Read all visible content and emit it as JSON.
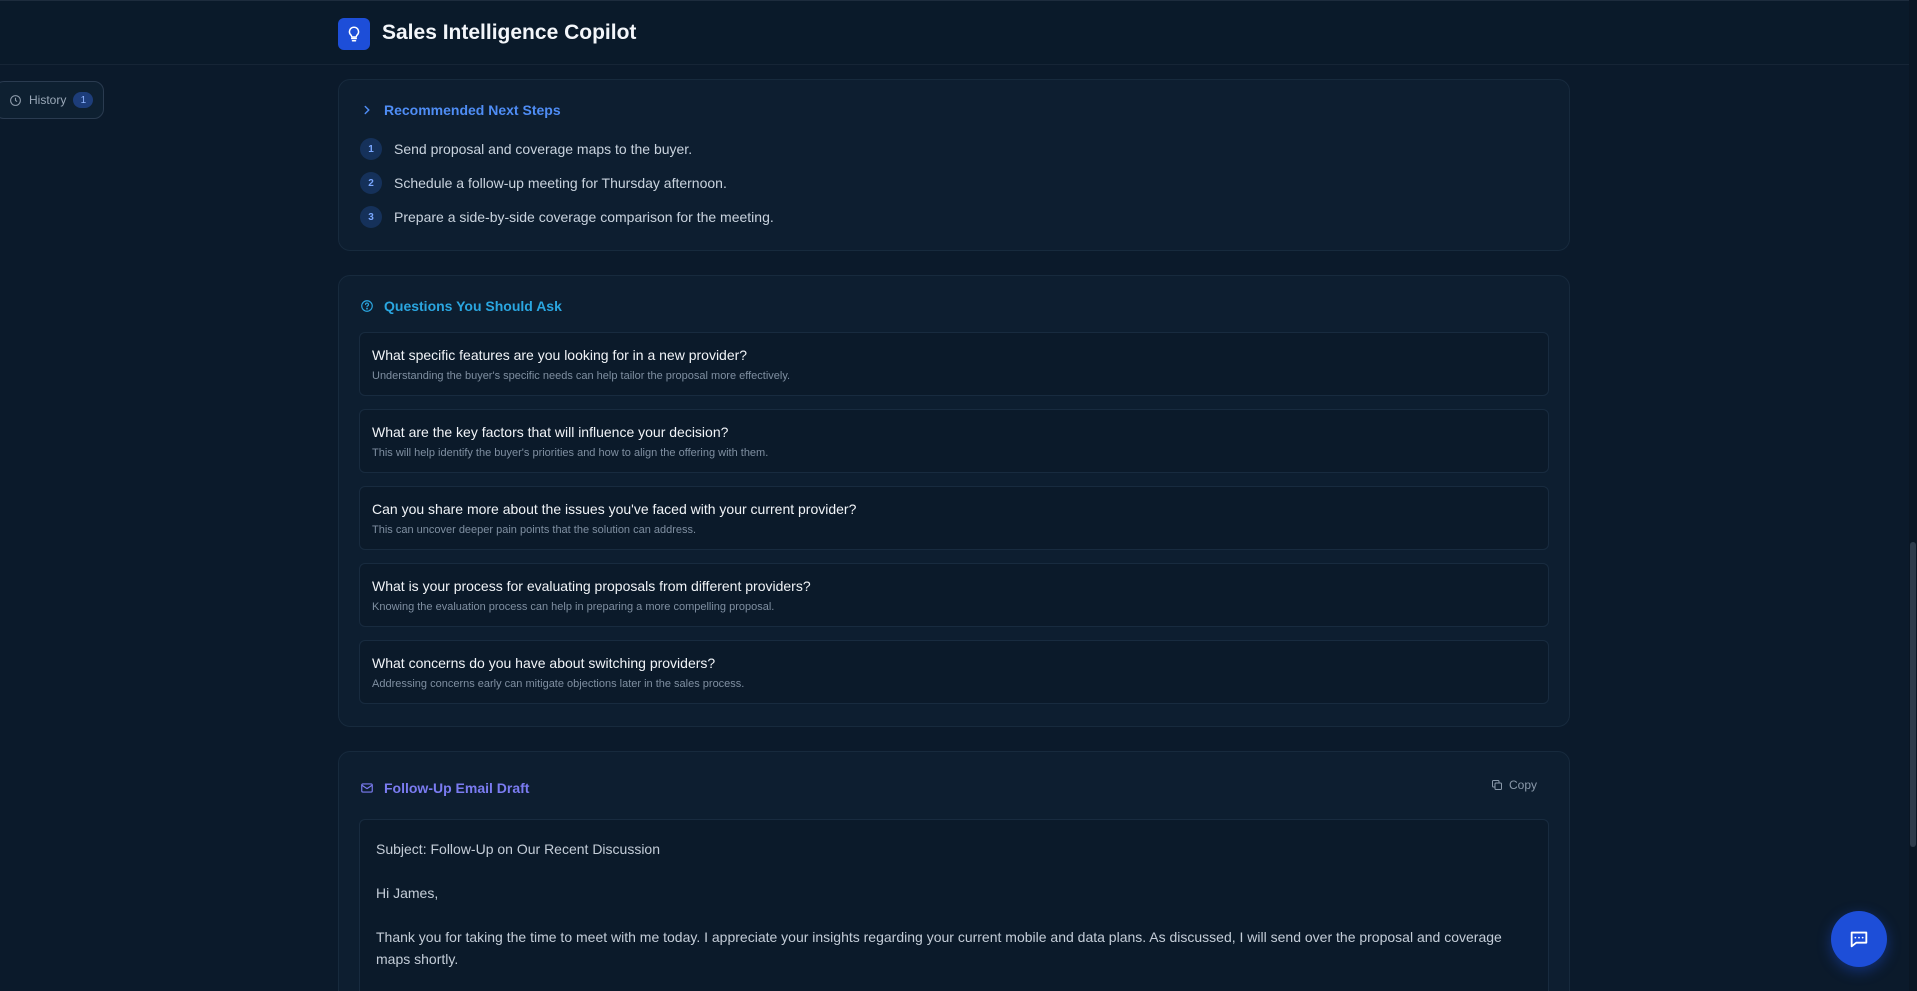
{
  "app": {
    "title": "Sales Intelligence Copilot",
    "logo_icon": "lightbulb-icon",
    "accent": "#1d4ed8"
  },
  "history": {
    "label": "History",
    "count": "1"
  },
  "next_steps": {
    "heading": "Recommended Next Steps",
    "items": [
      {
        "num": "1",
        "text": "Send proposal and coverage maps to the buyer."
      },
      {
        "num": "2",
        "text": "Schedule a follow-up meeting for Thursday afternoon."
      },
      {
        "num": "3",
        "text": "Prepare a side-by-side coverage comparison for the meeting."
      }
    ]
  },
  "questions": {
    "heading": "Questions You Should Ask",
    "items": [
      {
        "q": "What specific features are you looking for in a new provider?",
        "why": "Understanding the buyer's specific needs can help tailor the proposal more effectively."
      },
      {
        "q": "What are the key factors that will influence your decision?",
        "why": "This will help identify the buyer's priorities and how to align the offering with them."
      },
      {
        "q": "Can you share more about the issues you've faced with your current provider?",
        "why": "This can uncover deeper pain points that the solution can address."
      },
      {
        "q": "What is your process for evaluating proposals from different providers?",
        "why": "Knowing the evaluation process can help in preparing a more compelling proposal."
      },
      {
        "q": "What concerns do you have about switching providers?",
        "why": "Addressing concerns early can mitigate objections later in the sales process."
      }
    ]
  },
  "email": {
    "heading": "Follow-Up Email Draft",
    "copy_label": "Copy",
    "subject": "Subject: Follow-Up on Our Recent Discussion",
    "greeting": "Hi James,",
    "body": "Thank you for taking the time to meet with me today. I appreciate your insights regarding your current mobile and data plans. As discussed, I will send over the proposal and coverage maps shortly."
  }
}
